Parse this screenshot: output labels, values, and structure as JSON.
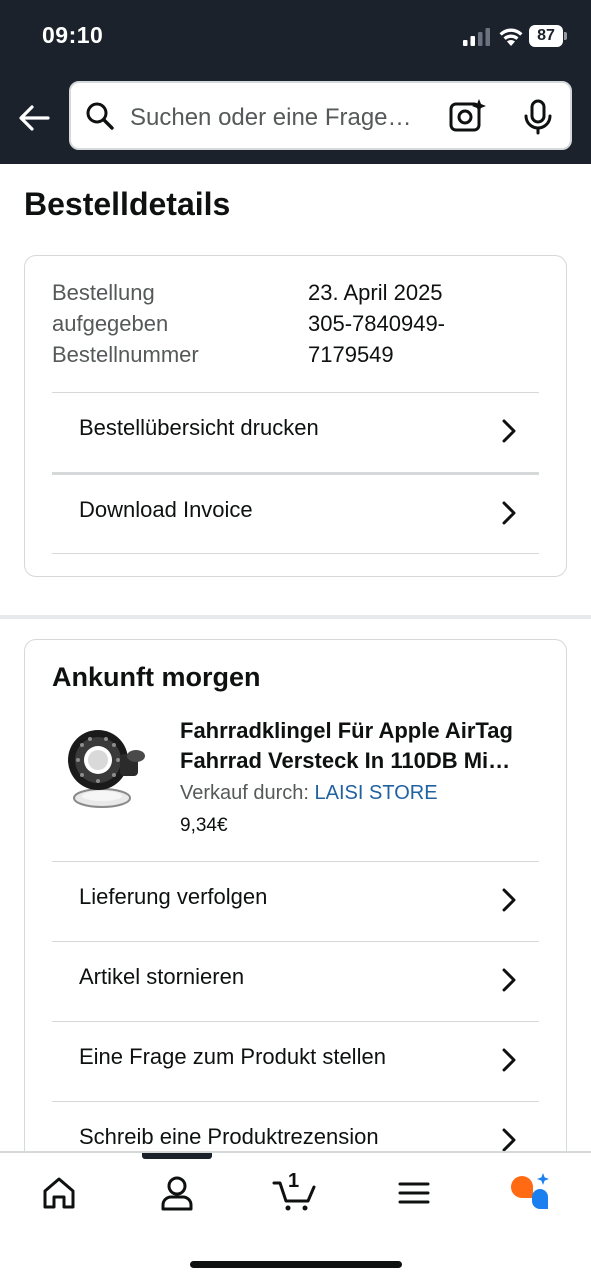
{
  "status_bar": {
    "time": "09:10",
    "battery": "87"
  },
  "search": {
    "placeholder": "Suchen oder eine Frage…"
  },
  "page": {
    "title": "Bestelldetails"
  },
  "order_info": {
    "label_line1": "Bestellung",
    "label_line2": "aufgegeben",
    "label_line3": "Bestellnummer",
    "date": "23. April 2025",
    "number_line1": "305-7840949-",
    "number_line2": "7179549"
  },
  "order_actions": [
    {
      "label": "Bestellübersicht drucken"
    },
    {
      "label": "Download Invoice"
    }
  ],
  "shipment": {
    "title": "Ankunft morgen",
    "product_title_line1": "Fahrradklingel Für Apple AirTag",
    "product_title_line2": "Fahrrad Versteck In 110DB Mi…",
    "seller_prefix": "Verkauf durch: ",
    "seller_name": "LAISI STORE",
    "price": "9,34€",
    "actions": [
      {
        "label": "Lieferung verfolgen"
      },
      {
        "label": "Artikel stornieren"
      },
      {
        "label": "Eine Frage zum Produkt stellen"
      },
      {
        "label": "Schreib eine Produktrezension"
      }
    ]
  },
  "bottom_nav": {
    "items": [
      "home-icon",
      "account-icon",
      "cart-icon",
      "menu-icon",
      "rufus-icon"
    ],
    "cart_count": "1"
  },
  "colors": {
    "header_bg": "#1b222b",
    "link": "#2162a1",
    "border": "#d5d9d9",
    "rufus_orange": "#ff6a13",
    "rufus_blue": "#1b7ff0"
  }
}
